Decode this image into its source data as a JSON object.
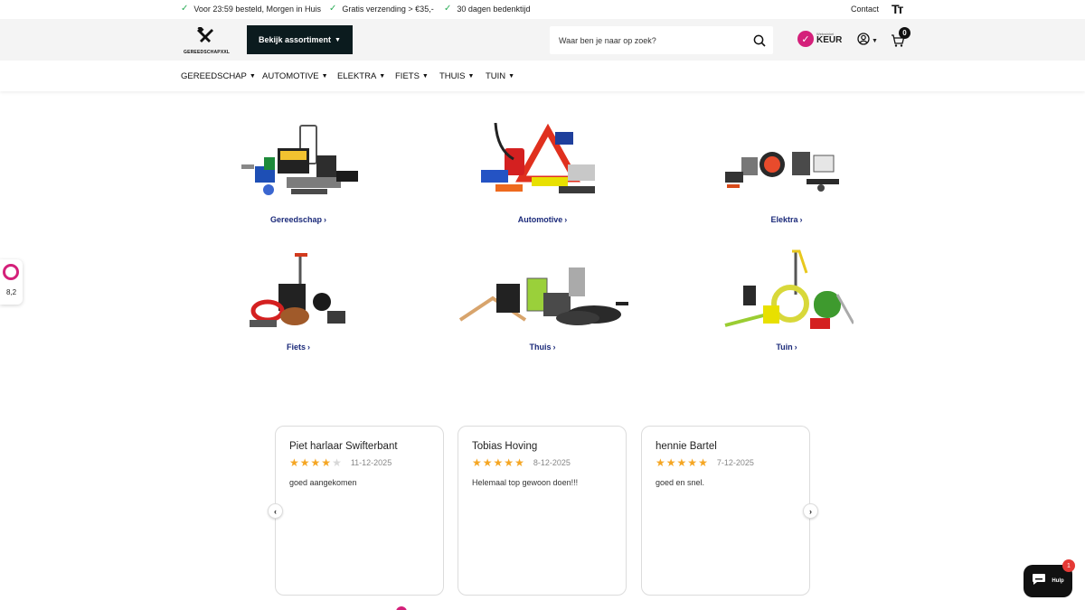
{
  "topbar": {
    "usps": [
      "Voor 23:59 besteld, Morgen in Huis",
      "Gratis verzending > €35,-",
      "30 dagen bedenktijd"
    ],
    "contact": "Contact",
    "text_size_icon": "Tт"
  },
  "header": {
    "logo_text": "GEREEDSCHAPXXL",
    "assortment_button": "Bekijk assortiment",
    "search_placeholder": "Waar ben je naar op zoek?",
    "keur_small": "Webwinkel",
    "keur_big": "KEUR",
    "cart_count": "0"
  },
  "nav": {
    "items": [
      "GEREEDSCHAP",
      "AUTOMOTIVE",
      "ELEKTRA",
      "FIETS",
      "THUIS",
      "TUIN"
    ]
  },
  "categories": [
    {
      "label": "Gereedschap",
      "icon": "tools-collection"
    },
    {
      "label": "Automotive",
      "icon": "car-accessories"
    },
    {
      "label": "Elektra",
      "icon": "electrical-lamps"
    },
    {
      "label": "Fiets",
      "icon": "bike-accessories"
    },
    {
      "label": "Thuis",
      "icon": "kitchen-home"
    },
    {
      "label": "Tuin",
      "icon": "garden-tools"
    }
  ],
  "side_widget": {
    "score": "8,2"
  },
  "reviews": [
    {
      "name": "Piet harlaar Swifterbant",
      "rating": 4,
      "date": "11-12-2025",
      "text": "goed aangekomen"
    },
    {
      "name": "Tobias Hoving",
      "rating": 5,
      "date": "8-12-2025",
      "text": "Helemaal top gewoon doen!!!"
    },
    {
      "name": "hennie Bartel",
      "rating": 5,
      "date": "7-12-2025",
      "text": "goed en snel."
    }
  ],
  "chat": {
    "label": "Hulp",
    "badge": "1"
  },
  "colors": {
    "accent_dark": "#0b1b1e",
    "category_link": "#1b2a7a",
    "star": "#f5a623",
    "keur_pink": "#d4207a",
    "check_green": "#2eae5a"
  }
}
